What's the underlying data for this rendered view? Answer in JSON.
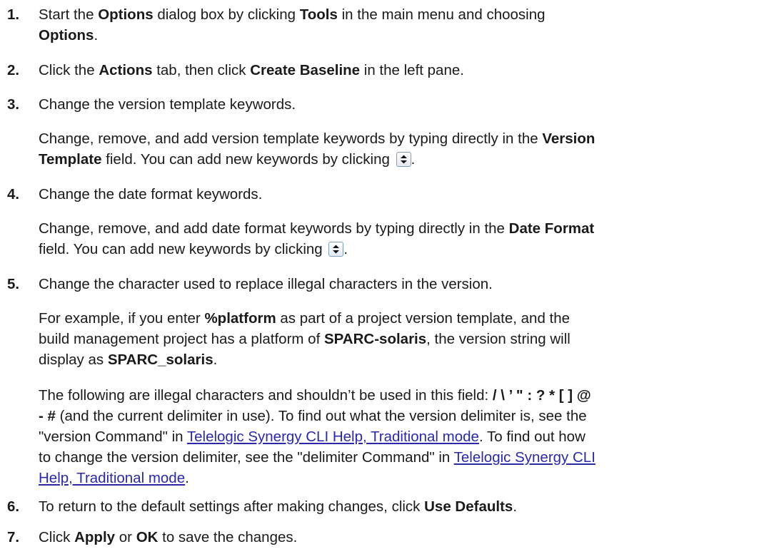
{
  "steps": [
    {
      "num": "1.",
      "line1": [
        "Start the ",
        "Options",
        " dialog box by clicking ",
        "Tools",
        " in the main menu and choosing"
      ],
      "line2": [
        "Options",
        "."
      ]
    },
    {
      "num": "2.",
      "parts": [
        "Click the ",
        "Actions",
        " tab, then click ",
        "Create Baseline",
        " in the left pane."
      ]
    },
    {
      "num": "3.",
      "text": "Change the version template keywords.",
      "para": {
        "line1": [
          "Change, remove, and add version template keywords by typing directly in the ",
          "Version"
        ],
        "line2": [
          "Template",
          " field. You can add new keywords by clicking ",
          "."
        ]
      }
    },
    {
      "num": "4.",
      "text": "Change the date format keywords.",
      "para": {
        "line1": [
          "Change, remove, and add date format keywords by typing directly in the ",
          "Date Format"
        ],
        "line2": [
          "field. You can add new keywords by clicking ",
          "."
        ]
      }
    },
    {
      "num": "5.",
      "text": "Change the character used to replace illegal characters in the version.",
      "para1": {
        "line1": [
          "For example, if you enter ",
          "%platform",
          " as part of a project version template, and the"
        ],
        "line2": [
          "build management project has a platform of ",
          "SPARC-solaris",
          ", the version string will"
        ],
        "line3": [
          "display as ",
          "SPARC_solaris",
          "."
        ]
      },
      "para2": {
        "line1": [
          "The following are illegal characters and shouldn’t be used in this field: ",
          "/ \\ ’ \" : ? * [ ] @"
        ],
        "line2": [
          "- #",
          " (and the current delimiter in use). To find out what the version delimiter is, see the"
        ],
        "line3": [
          "\"version Command\" in ",
          "Telelogic Synergy CLI Help, Traditional mode",
          ". To find out how"
        ],
        "line4": [
          "to change the version delimiter, see the \"delimiter Command\" in ",
          "Telelogic Synergy CLI"
        ],
        "line5": [
          "Help, Traditional mode",
          "."
        ]
      }
    },
    {
      "num": "6.",
      "parts": [
        "To return to the default settings after making changes, click ",
        "Use Defaults",
        "."
      ]
    },
    {
      "num": "7.",
      "parts": [
        "Click ",
        "Apply",
        " or ",
        "OK",
        " to save the changes."
      ]
    }
  ],
  "icons": {
    "spinner": "spinner-up-down-icon"
  },
  "colors": {
    "text": "#1a1a1a",
    "link": "#2a2aa8"
  }
}
